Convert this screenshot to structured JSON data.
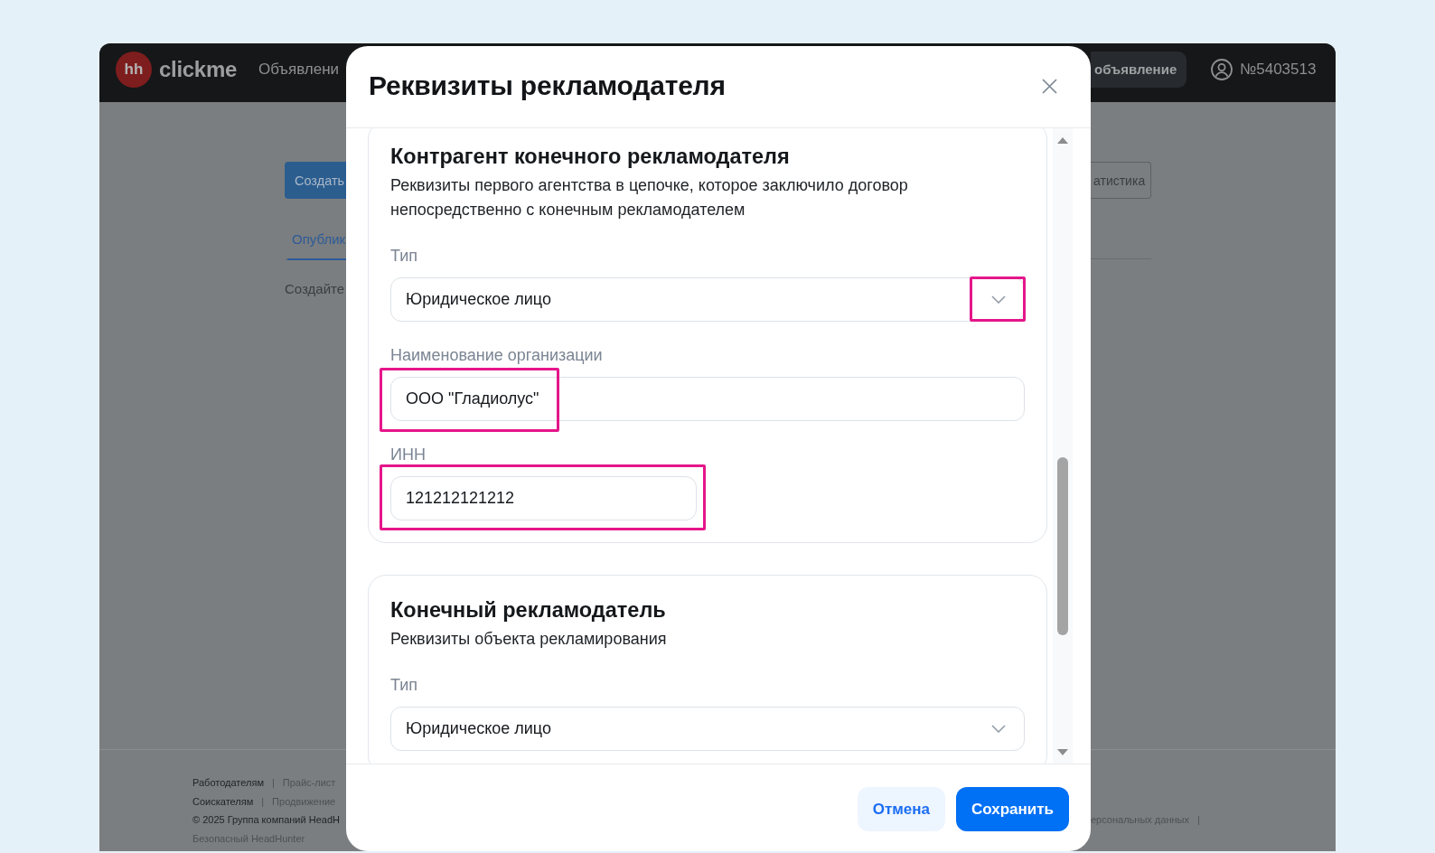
{
  "page": {
    "logo": {
      "badge": "hh",
      "name": "clickme"
    },
    "nav": [
      {
        "label": "Объявлени"
      }
    ],
    "header_button": "объявление",
    "account": "№5403513",
    "create_button": "Создать",
    "stats_button": "атистика",
    "tabs": [
      {
        "label": "Опублик",
        "selected": true
      }
    ],
    "empty_text": "Создайте",
    "footer": {
      "groups": [
        {
          "title": "Работодателям",
          "separator": "|",
          "link": "Прайс-лист"
        },
        {
          "title": "Соискателям",
          "separator": "|",
          "link": "Продвижение"
        }
      ],
      "copyright": "© 2025 Группа компаний HeadH",
      "safety": "Безопасный HeadHunter",
      "right": {
        "link": "ерсональных данных",
        "separator": "|"
      }
    }
  },
  "dialog": {
    "title": "Реквизиты рекламодателя",
    "sections": [
      {
        "title": "Контрагент конечного рекламодателя",
        "description": "Реквизиты первого агентства в цепочке, которое заключило договор непосредственно с конечным рекламодателем",
        "fields": [
          {
            "kind": "select",
            "label": "Тип",
            "value": "Юридическое лицо",
            "highlighted": true
          },
          {
            "kind": "text",
            "label": "Наименование организации",
            "value": "ООО \"Гладиолус\"",
            "highlighted": true
          },
          {
            "kind": "number",
            "label": "ИНН",
            "value": "121212121212",
            "highlighted": true
          }
        ]
      },
      {
        "title": "Конечный рекламодатель",
        "description": "Реквизиты объекта рекламирования",
        "fields": [
          {
            "kind": "select",
            "label": "Тип",
            "value": "Юридическое лицо",
            "highlighted": false
          }
        ]
      }
    ],
    "buttons": [
      {
        "kind": "secondary",
        "label": "Отмена"
      },
      {
        "kind": "primary",
        "label": "Сохранить"
      }
    ]
  }
}
